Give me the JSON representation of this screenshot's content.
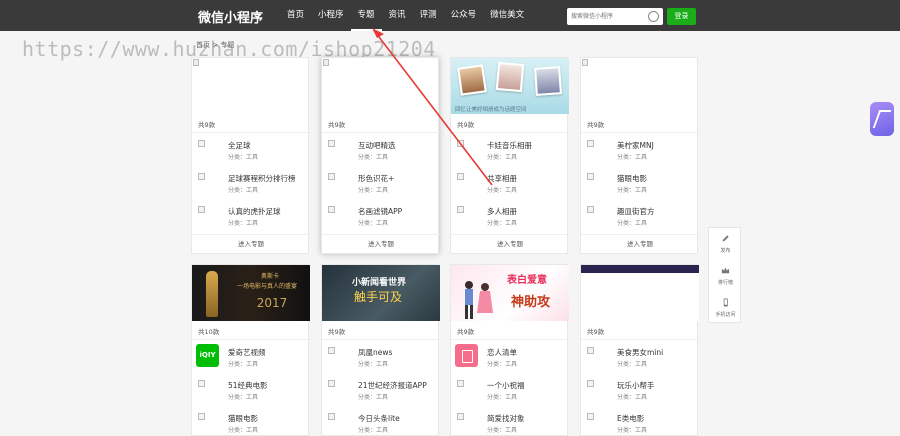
{
  "site": {
    "logo": "微信小程序"
  },
  "nav": {
    "items": [
      "首页",
      "小程序",
      "专题",
      "资讯",
      "评测",
      "公众号",
      "微信美文"
    ],
    "active_index": 2
  },
  "search": {
    "placeholder": "搜索微信小程序",
    "login_label": "登录"
  },
  "watermark": "https://www.huzhan.com/ishop21204",
  "breadcrumb": "首页 > 专题",
  "category_label": "分类：工具",
  "enter_label": "进入专题",
  "colors": {
    "topbar": "#3a3a3a",
    "login": "#1aad19",
    "annotation": "#e53935"
  },
  "cards": [
    {
      "count": "共9款",
      "cover": "broken",
      "apps": [
        {
          "name": "全足球",
          "icon": "broken-image-icon"
        },
        {
          "name": "足球赛程积分排行榜",
          "icon": "broken-image-icon"
        },
        {
          "name": "认真的虎扑足球",
          "icon": "broken-image-icon"
        }
      ]
    },
    {
      "count": "共9款",
      "cover": "broken",
      "apps": [
        {
          "name": "互动吧精选",
          "icon": "broken-image-icon"
        },
        {
          "name": "形色识花+",
          "icon": "broken-image-icon"
        },
        {
          "name": "名画滤镜APP",
          "icon": "broken-image-icon"
        }
      ]
    },
    {
      "count": "共9款",
      "cover": "photo",
      "cover_caption": "回忆让美好相册成为话题空间",
      "apps": [
        {
          "name": "卡娃音乐相册",
          "icon": "broken-image-icon"
        },
        {
          "name": "共享相册",
          "icon": "broken-image-icon"
        },
        {
          "name": "多人相册",
          "icon": "broken-image-icon"
        }
      ]
    },
    {
      "count": "共9款",
      "cover": "broken",
      "apps": [
        {
          "name": "美柠家MNJ",
          "icon": "broken-image-icon"
        },
        {
          "name": "猫眼电影",
          "icon": "broken-image-icon"
        },
        {
          "name": "趣皿街官方",
          "icon": "broken-image-icon"
        }
      ]
    },
    {
      "count": "共10款",
      "cover": "film",
      "cover_text": {
        "title": "奥斯卡",
        "subtitle": "一场电影与真人的盛宴",
        "year": "2017"
      },
      "apps": [
        {
          "name": "爱奇艺视频",
          "icon": "iqiyi-icon",
          "icon_text": "iQIY"
        },
        {
          "name": "51经典电影",
          "icon": "broken-image-icon"
        },
        {
          "name": "猫眼电影",
          "icon": "broken-image-icon"
        }
      ]
    },
    {
      "count": "共9款",
      "cover": "news",
      "cover_text": {
        "title": "小新闻看世界",
        "big": "触手可及"
      },
      "apps": [
        {
          "name": "凤凰news",
          "icon": "broken-image-icon"
        },
        {
          "name": "21世纪经济报道APP",
          "icon": "broken-image-icon"
        },
        {
          "name": "今日头条lite",
          "icon": "broken-image-icon"
        }
      ]
    },
    {
      "count": "共9款",
      "cover": "pink",
      "cover_text": {
        "a": "表白爱意",
        "b": "神助攻"
      },
      "apps": [
        {
          "name": "恋人清单",
          "icon": "list-icon"
        },
        {
          "name": "一个小祝福",
          "icon": "broken-image-icon"
        },
        {
          "name": "简爱找对象",
          "icon": "broken-image-icon"
        }
      ]
    },
    {
      "count": "共9款",
      "cover": "stripe",
      "apps": [
        {
          "name": "美食男女mini",
          "icon": "broken-image-icon"
        },
        {
          "name": "玩乐小帮手",
          "icon": "broken-image-icon"
        },
        {
          "name": "E类电影",
          "icon": "broken-image-icon"
        }
      ]
    }
  ],
  "float_panel": [
    {
      "label": "发布",
      "icon": "pencil-icon"
    },
    {
      "label": "排行榜",
      "icon": "crown-icon"
    },
    {
      "label": "手机访问",
      "icon": "phone-icon"
    }
  ]
}
